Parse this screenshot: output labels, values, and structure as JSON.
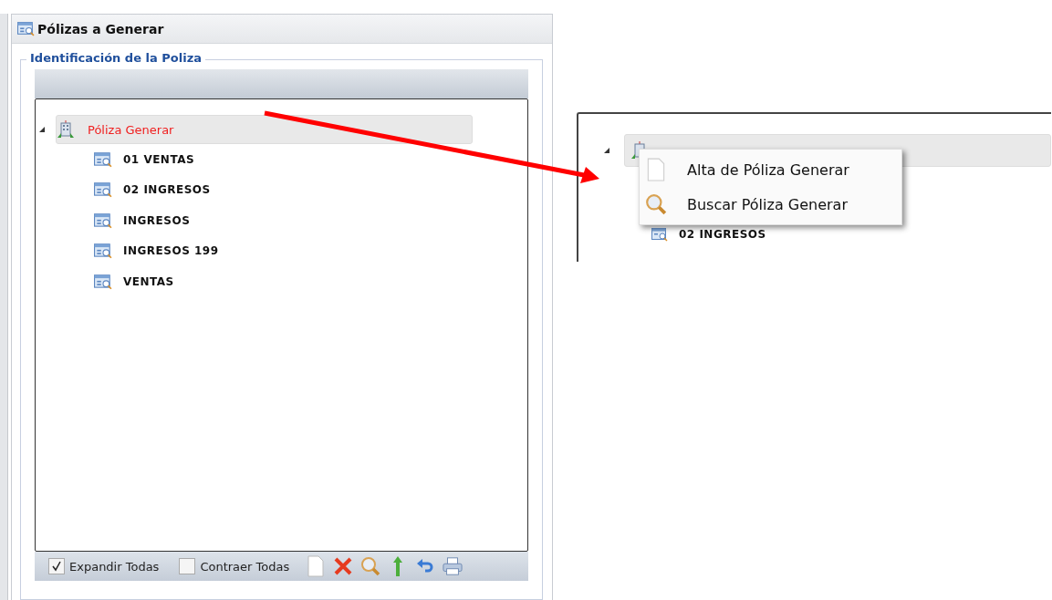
{
  "window": {
    "title": "Pólizas a Generar"
  },
  "fieldset": {
    "legend": "Identificación de la Poliza"
  },
  "tree": {
    "label": "Póliza Generar",
    "expanded": true,
    "selected": true,
    "children": [
      {
        "label": "01 VENTAS",
        "selected": false
      },
      {
        "label": "02 INGRESOS",
        "selected": false
      },
      {
        "label": "INGRESOS",
        "selected": false
      },
      {
        "label": "INGRESOS 199",
        "selected": false
      },
      {
        "label": "VENTAS",
        "selected": false
      }
    ]
  },
  "toolbar": {
    "checkboxes": [
      {
        "label": "Expandir Todas",
        "checked": true
      },
      {
        "label": "Contraer Todas",
        "checked": false
      }
    ]
  },
  "zoom_inset": {
    "context_menu": [
      {
        "label": "Alta de Póliza Generar",
        "kind": "new"
      },
      {
        "label": "Buscar Póliza Generar",
        "kind": "search"
      }
    ],
    "visible_rows": [
      {
        "label": "02 INGRESOS"
      }
    ]
  }
}
